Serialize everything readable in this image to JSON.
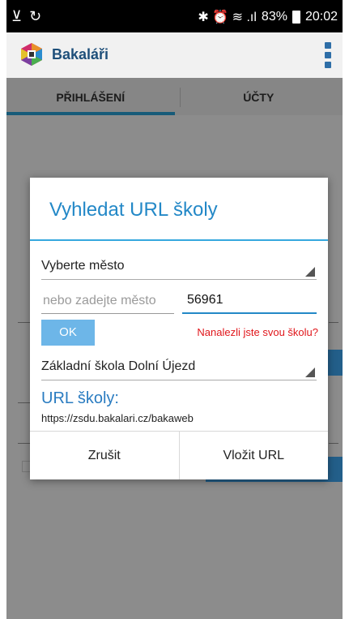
{
  "status_bar": {
    "left_icons": "⊻ ↻",
    "right_icons": "✱ ⏰ ≋ .ıl",
    "battery": "83%",
    "time": "20:02"
  },
  "app_bar": {
    "title": "Bakaláři",
    "menu_icon": "overflow-menu-icon"
  },
  "tabs": [
    {
      "label": "PŘIHLÁŠENÍ",
      "active": true
    },
    {
      "label": "ÚČTY",
      "active": false
    }
  ],
  "dialog": {
    "title": "Vyhledat URL školy",
    "city_select": {
      "value": "Vyberte město"
    },
    "city_input": {
      "placeholder": "nebo zadejte město"
    },
    "code_input": {
      "value": "56961"
    },
    "ok_label": "OK",
    "found_link": "Nanalezli jste svou školu?",
    "school_select": {
      "value": "Základní škola Dolní Újezd"
    },
    "url_label": "URL školy:",
    "url_value": "https://zsdu.bakalari.cz/bakaweb",
    "cancel_label": "Zrušit",
    "insert_label": "Vložit URL"
  },
  "colors": {
    "accent": "#2388c7",
    "tab_indicator": "#2aa7dc",
    "ok_button": "#6db6e8",
    "link_red": "#e0161b"
  }
}
